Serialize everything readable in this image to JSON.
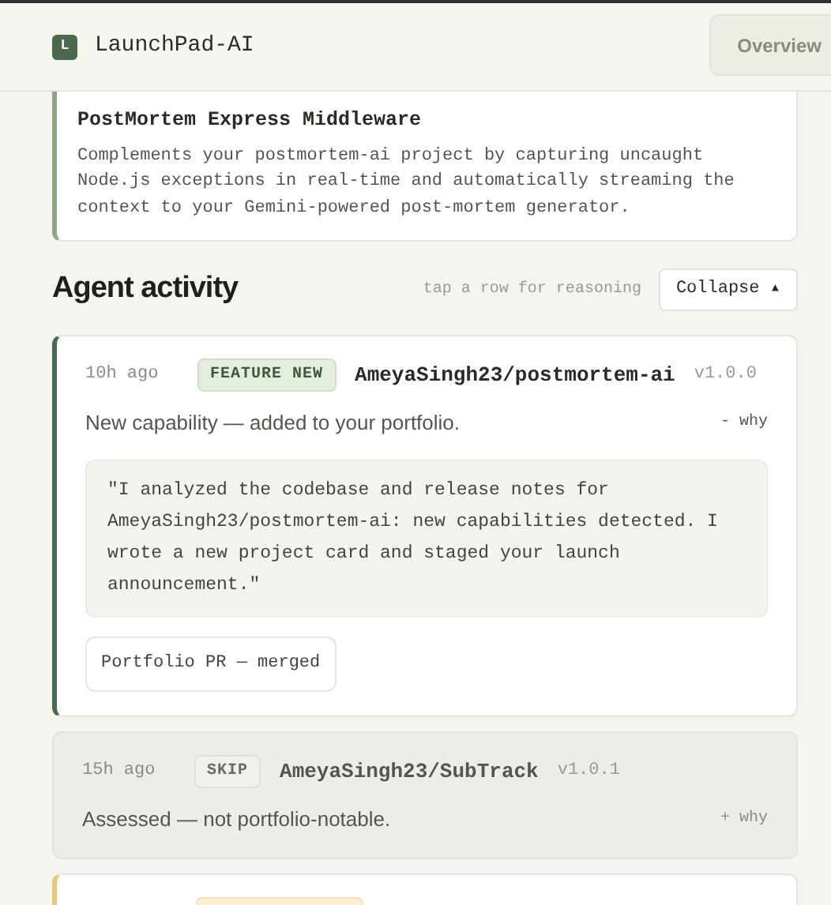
{
  "header": {
    "logo_letter": "L",
    "brand": "LaunchPad-AI",
    "nav_tab": {
      "label": "Overview",
      "selected": false
    }
  },
  "project_card": {
    "title": "PostMortem Express Middleware",
    "description": "Complements your postmortem-ai project by capturing uncaught Node.js exceptions in real-time and automatically streaming the context to your Gemini-powered post-mortem generator."
  },
  "activity": {
    "title": "Agent activity",
    "hint": "tap a row for reasoning",
    "toggle": "Collapse ▴",
    "items": [
      {
        "kind": "feature",
        "time": "10h ago",
        "badge": "FEATURE NEW",
        "repo": "AmeyaSingh23/postmortem-ai",
        "version": "v1.0.0",
        "summary": "New capability — added to your portfolio.",
        "why": "- why",
        "expanded": true,
        "reasoning": "\"I analyzed the codebase and release notes for AmeyaSingh23/postmortem-ai: new capabilities detected. I wrote a new project card and staged your launch announcement.\"",
        "status": "Portfolio PR — merged"
      },
      {
        "kind": "skip",
        "time": "15h ago",
        "badge": "SKIP",
        "repo": "AmeyaSingh23/SubTrack",
        "version": "v1.0.1",
        "summary": "Assessed — not portfolio-notable.",
        "why": "+ why",
        "expanded": false
      },
      {
        "kind": "pending"
      }
    ]
  }
}
